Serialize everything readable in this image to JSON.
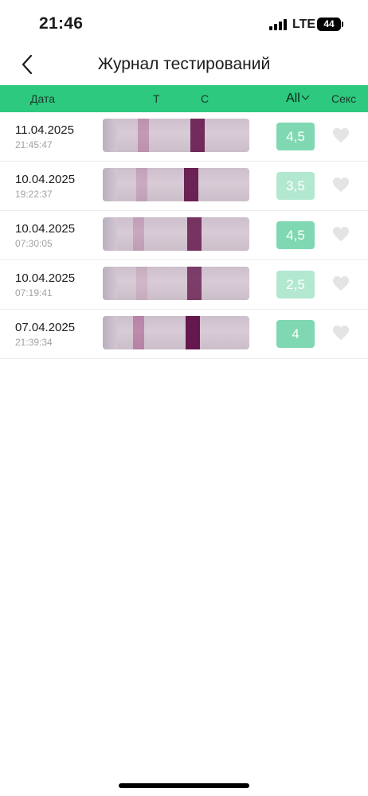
{
  "status_bar": {
    "time": "21:46",
    "network": "LTE",
    "battery": "44"
  },
  "nav": {
    "title": "Журнал тестирований",
    "back_icon": "chevron-left-icon"
  },
  "columns": {
    "date": "Дата",
    "t": "T",
    "c": "C",
    "filter": "All",
    "sex": "Секс"
  },
  "colors": {
    "header_green": "#2dc97f",
    "score_strong": "#7fd8b1",
    "score_light": "#b3e8d0",
    "heart_gray": "#e4e4e4"
  },
  "records": [
    {
      "date": "11.04.2025",
      "time": "21:45:47",
      "score": "4,5",
      "t_intensity": 0.3,
      "c_intensity": 0.85
    },
    {
      "date": "10.04.2025",
      "time": "19:22:37",
      "score": "3,5",
      "t_intensity": 0.2,
      "c_intensity": 0.9
    },
    {
      "date": "10.04.2025",
      "time": "07:30:05",
      "score": "4,5",
      "t_intensity": 0.22,
      "c_intensity": 0.8
    },
    {
      "date": "10.04.2025",
      "time": "07:19:41",
      "score": "2,5",
      "t_intensity": 0.12,
      "c_intensity": 0.75
    },
    {
      "date": "07.04.2025",
      "time": "21:39:34",
      "score": "4",
      "t_intensity": 0.4,
      "c_intensity": 0.95
    }
  ]
}
